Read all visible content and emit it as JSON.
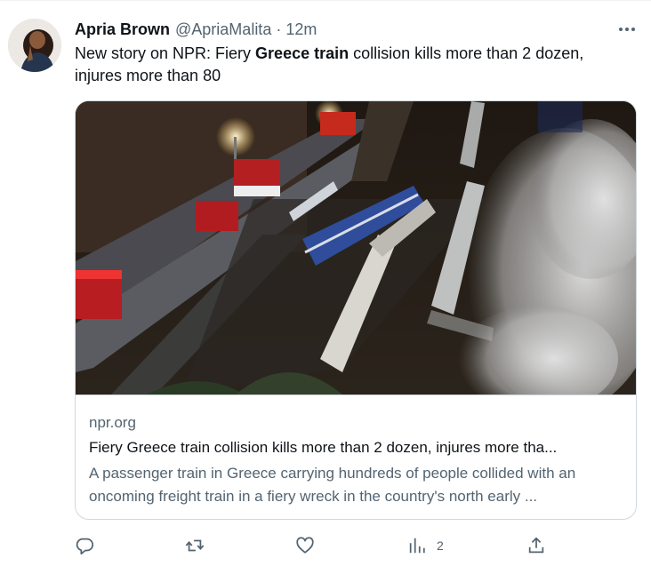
{
  "tweet": {
    "author_name": "Apria Brown",
    "author_handle": "@ApriaMalita",
    "separator": " · ",
    "time": "12m",
    "text_before": "New story on NPR: Fiery ",
    "text_bold": "Greece train",
    "text_after": " collision kills more than 2 dozen, injures more than 80"
  },
  "card": {
    "domain": "npr.org",
    "title": "Fiery Greece train collision kills more than 2 dozen, injures more tha...",
    "description": "A passenger train in Greece carrying hundreds of people collided with an oncoming freight train in a fiery wreck in the country's north early ..."
  },
  "actions": {
    "reply_icon": "reply-icon",
    "retweet_icon": "retweet-icon",
    "like_icon": "like-icon",
    "views_icon": "views-icon",
    "views_count": "2",
    "share_icon": "share-icon"
  },
  "colors": {
    "text": "#0f1419",
    "secondary": "#536471",
    "border": "#cfd9de"
  }
}
